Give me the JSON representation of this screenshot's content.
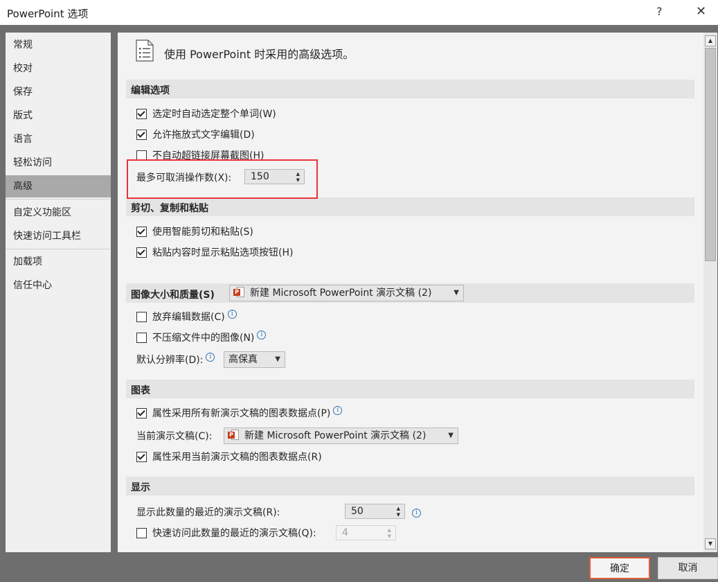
{
  "window": {
    "title": "PowerPoint 选项",
    "help_label": "?",
    "close_label": "✕"
  },
  "sidebar": {
    "items": [
      {
        "label": "常规"
      },
      {
        "label": "校对"
      },
      {
        "label": "保存"
      },
      {
        "label": "版式"
      },
      {
        "label": "语言"
      },
      {
        "label": "轻松访问"
      },
      {
        "label": "高级",
        "selected": true
      },
      {
        "label": "自定义功能区"
      },
      {
        "label": "快速访问工具栏"
      },
      {
        "label": "加载项"
      },
      {
        "label": "信任中心"
      }
    ]
  },
  "header": {
    "text": "使用 PowerPoint 时采用的高级选项。"
  },
  "sections": {
    "editing": {
      "title": "编辑选项",
      "opt1": "选定时自动选定整个单词(W)",
      "opt2": "允许拖放式文字编辑(D)",
      "opt3": "不自动超链接屏幕截图(H)",
      "undo_label": "最多可取消操作数(X):",
      "undo_value": "150"
    },
    "clipboard": {
      "title": "剪切、复制和粘贴",
      "opt1": "使用智能剪切和粘贴(S)",
      "opt2": "粘贴内容时显示粘贴选项按钮(H)"
    },
    "image": {
      "title": "图像大小和质量(S)",
      "doc_combo": "新建 Microsoft PowerPoint 演示文稿 (2)",
      "opt1": "放弃编辑数据(C)",
      "opt2": "不压缩文件中的图像(N)",
      "res_label": "默认分辨率(D):",
      "res_value": "高保真"
    },
    "chart": {
      "title": "图表",
      "opt1": "属性采用所有新演示文稿的图表数据点(P)",
      "current_label": "当前演示文稿(C):",
      "doc_combo": "新建 Microsoft PowerPoint 演示文稿 (2)",
      "opt2": "属性采用当前演示文稿的图表数据点(R)"
    },
    "display": {
      "title": "显示",
      "recent_label": "显示此数量的最近的演示文稿(R):",
      "recent_value": "50",
      "quick_label": "快速访问此数量的最近的演示文稿(Q):",
      "quick_value": "4"
    }
  },
  "buttons": {
    "ok": "确定",
    "cancel": "取消"
  },
  "colors": {
    "highlight": "#e8333c",
    "ok_border": "#e05a36",
    "ppt_icon": "#c43e1c",
    "info_icon": "#2e75b6"
  }
}
